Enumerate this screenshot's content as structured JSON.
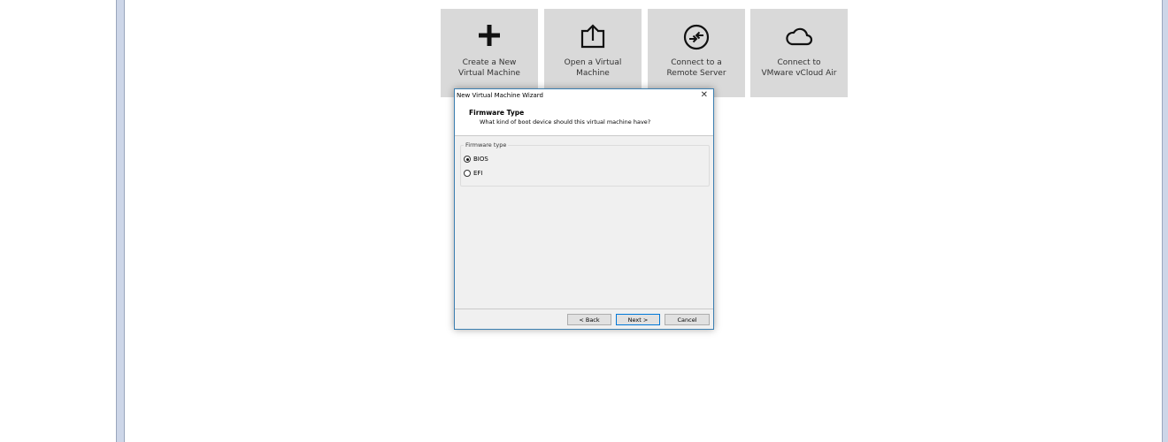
{
  "tiles": [
    {
      "label": "Create a New\nVirtual Machine",
      "icon": "plus-icon"
    },
    {
      "label": "Open a Virtual\nMachine",
      "icon": "open-vm-icon"
    },
    {
      "label": "Connect to a\nRemote Server",
      "icon": "remote-server-icon"
    },
    {
      "label": "Connect to\nVMware vCloud Air",
      "icon": "cloud-icon"
    }
  ],
  "dialog": {
    "title": "New Virtual Machine Wizard",
    "close_glyph": "✕",
    "header_title": "Firmware Type",
    "header_subtitle": "What kind of boot device should this virtual machine have?",
    "group_label": "Firmware type",
    "options": [
      {
        "label": "BIOS",
        "selected": true
      },
      {
        "label": "EFI",
        "selected": false
      }
    ],
    "buttons": {
      "back": "< Back",
      "next": "Next >",
      "cancel": "Cancel"
    }
  },
  "colors": {
    "accent": "#0078d7",
    "tile_bg": "#d9d9d9",
    "splitter": "#cdd6e8"
  }
}
